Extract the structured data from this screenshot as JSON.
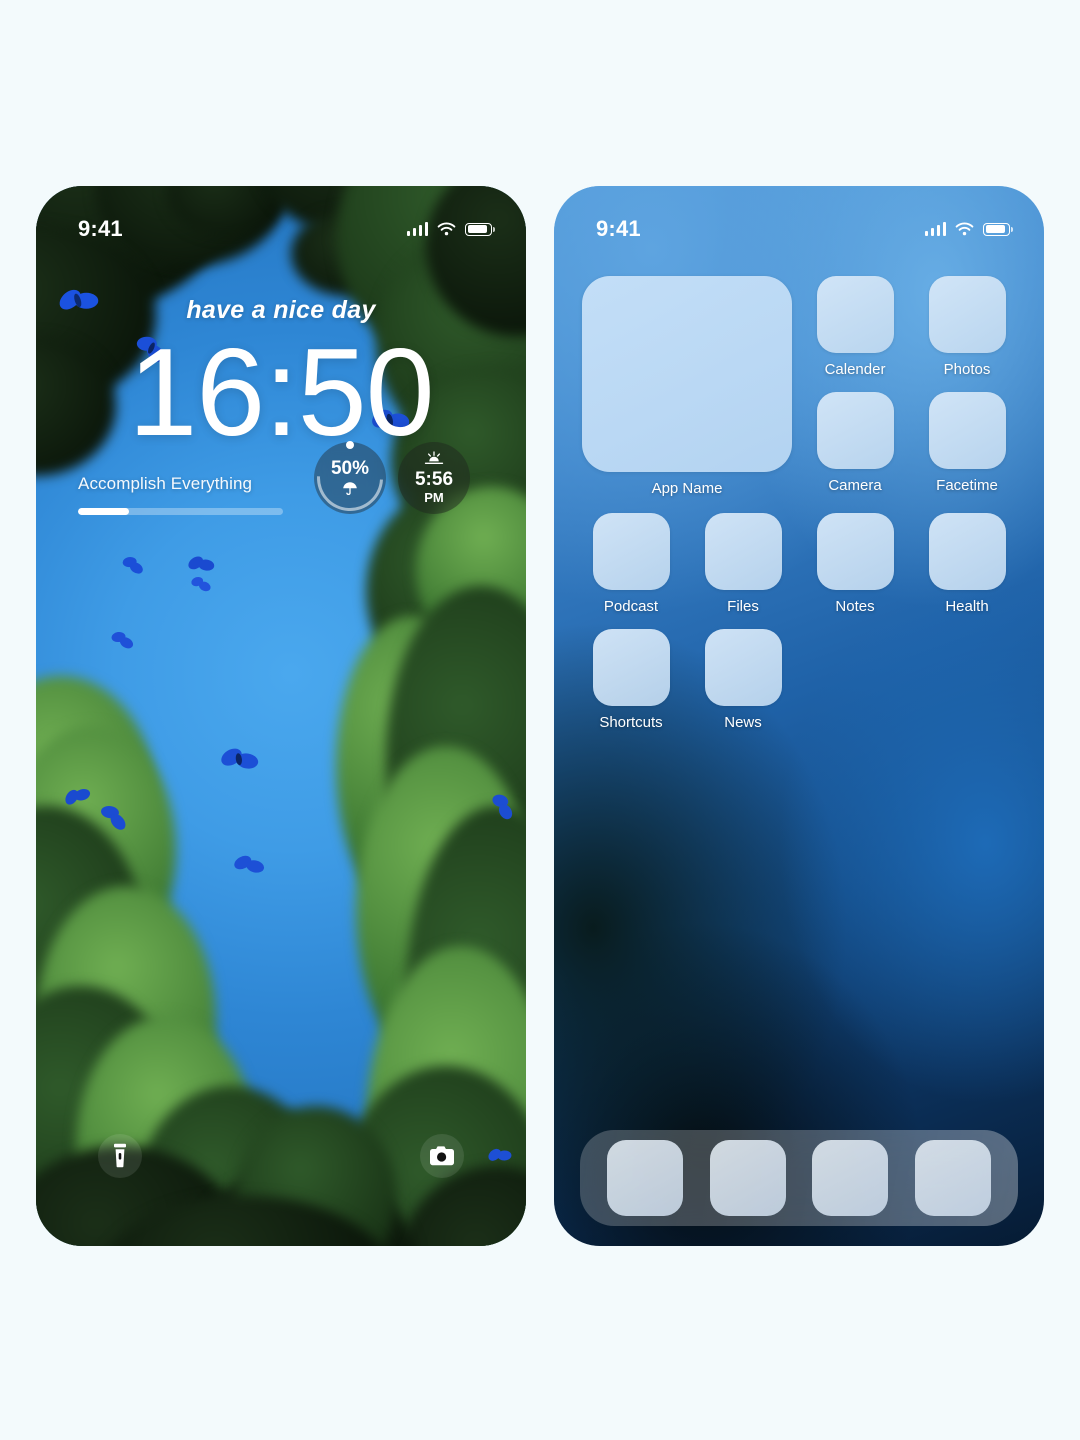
{
  "page": {
    "background_color": "#f3fafc",
    "screens": [
      "lock-screen",
      "home-screen"
    ]
  },
  "lock_screen": {
    "status_bar": {
      "time": "9:41",
      "cellular_icon": "signal-bars-icon",
      "wifi_icon": "wifi-icon",
      "battery_icon": "battery-icon"
    },
    "greeting": "have a nice day",
    "clock": "16:50",
    "task": {
      "label": "Accomplish Everything",
      "progress_percent": 25
    },
    "widgets": [
      {
        "name": "precipitation-widget",
        "value": "50%",
        "icon": "umbrella-icon",
        "ring_percent": 50
      },
      {
        "name": "sunset-widget",
        "icon": "sunset-icon",
        "time": "5:56",
        "period": "PM"
      }
    ],
    "actions": [
      {
        "name": "flashlight-button",
        "icon": "flashlight-icon"
      },
      {
        "name": "camera-button",
        "icon": "camera-icon"
      }
    ],
    "wallpaper": {
      "description": "blue sky with green conifer trees and blue morpho butterflies",
      "sky_color": "#3f9ce6",
      "foliage_color": "#2f5a2a",
      "butterfly_color": "#1b52e0"
    }
  },
  "home_screen": {
    "status_bar": {
      "time": "9:41",
      "cellular_icon": "signal-bars-icon",
      "wifi_icon": "wifi-icon",
      "battery_icon": "battery-icon"
    },
    "wallpaper": {
      "description": "blurred blue to dark navy gradient",
      "accent_color": "#2f7fc8",
      "dark_color": "#061b33"
    },
    "rows": [
      {
        "widget": {
          "label": "App Name",
          "size": "2x2"
        },
        "apps": [
          {
            "label": "Calender"
          },
          {
            "label": "Photos"
          },
          {
            "label": "Camera"
          },
          {
            "label": "Facetime"
          }
        ]
      },
      {
        "apps": [
          {
            "label": "Podcast"
          },
          {
            "label": "Files"
          },
          {
            "label": "Notes"
          },
          {
            "label": "Health"
          }
        ]
      },
      {
        "apps": [
          {
            "label": "Shortcuts"
          },
          {
            "label": "News"
          }
        ]
      }
    ],
    "dock": {
      "icon_count": 4,
      "icons": [
        {
          "label": ""
        },
        {
          "label": ""
        },
        {
          "label": ""
        },
        {
          "label": ""
        }
      ]
    }
  }
}
